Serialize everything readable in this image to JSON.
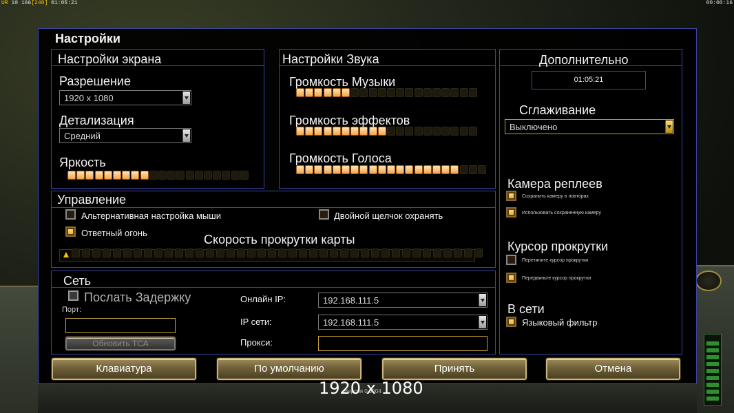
{
  "hud": {
    "top_left_prefix": "UR",
    "top_left_values": "10 166",
    "top_left_bracket": "[240]",
    "top_left_time": "01:05:21",
    "top_right_time": "00:00:16"
  },
  "panel": {
    "title": "Настройки"
  },
  "screen": {
    "title": "Настройки экрана",
    "resolution_label": "Разрешение",
    "resolution_value": "1920 x 1080",
    "detail_label": "Детализация",
    "detail_value": "Средний",
    "brightness_label": "Яркость",
    "brightness": {
      "filled": 9,
      "total": 20
    }
  },
  "sound": {
    "title": "Настройки Звука",
    "music_label": "Громкость Музыки",
    "music": {
      "filled": 6,
      "total": 20
    },
    "effects_label": "Громкость эффектов",
    "effects": {
      "filled": 10,
      "total": 20
    },
    "voice_label": "Громкость Голоса",
    "voice": {
      "filled": 18,
      "total": 21
    }
  },
  "extra": {
    "title": "Дополнительно",
    "clock": "01:05:21",
    "antialias_label": "Сглаживание",
    "antialias_value": "Выключено",
    "replay_camera_title": "Камера реплеев",
    "save_camera_label": "Сохранить камеру в повторах",
    "use_saved_camera_label": "Использовать сохраненную камеру",
    "scroll_cursor_title": "Курсор прокрутки",
    "drag_cursor_label": "Перетяните курсор прокрутки",
    "move_cursor_label": "Передвиньте курсор прокрутки",
    "online_title": "В сети",
    "language_filter_label": "Языковый фильтр"
  },
  "control": {
    "title": "Управление",
    "alt_mouse_label": "Альтернативная настройка мыши",
    "double_click_label": "Двойной щелчок охранять",
    "return_fire_label": "Ответный огонь",
    "scroll_speed_label": "Скорость прокрутки карты",
    "scroll_speed": {
      "filled": 0,
      "total": 40
    }
  },
  "network": {
    "title": "Сеть",
    "send_delay_label": "Послать Задержку",
    "port_label": "Порт:",
    "port_value": "",
    "update_button": "Обновить ТСА",
    "online_ip_label": "Онлайн IP:",
    "online_ip_value": "192.168.111.5",
    "lan_ip_label": "IP сети:",
    "lan_ip_value": "192.168.111.5",
    "proxy_label": "Прокси:",
    "proxy_value": ""
  },
  "buttons": {
    "keyboard": "Клавиатура",
    "defaults": "По умолчанию",
    "accept": "Принять",
    "cancel": "Отмена"
  },
  "overlay": {
    "resolution_text": "1920 x 1080",
    "small_text": "Версия 0.0004"
  },
  "colors": {
    "panel_border": "#3a45a8",
    "slider_on": "#f6a24a",
    "accent_gold": "#c9a43a"
  }
}
